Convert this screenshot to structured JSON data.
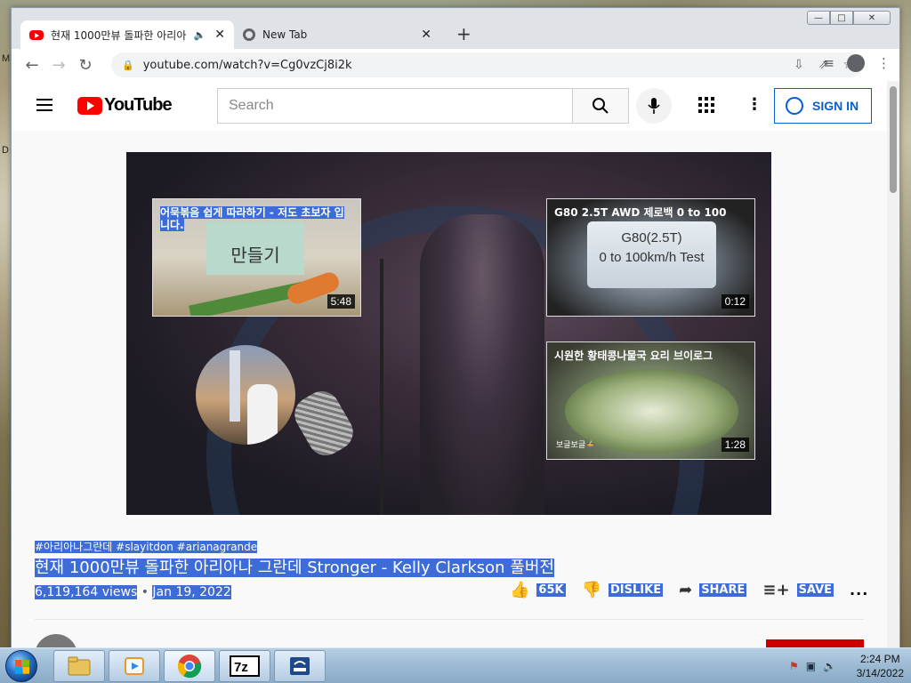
{
  "desktop": {
    "edge_labels": [
      "M",
      "D"
    ]
  },
  "window_controls": {
    "minimize": "—",
    "maximize": "□",
    "close": "✕"
  },
  "tabs": [
    {
      "title": "현재 1000만뷰 돌파한 아리아",
      "speaker": "🔈",
      "close": "✕",
      "favicon": "youtube-icon"
    },
    {
      "title": "New Tab",
      "close": "✕",
      "favicon": "chrome-icon"
    }
  ],
  "new_tab": "+",
  "address_bar": {
    "url": "youtube.com/watch?v=Cg0vzCj8i2k"
  },
  "youtube": {
    "logo_text": "YouTube",
    "search_placeholder": "Search",
    "signin_label": "SIGN IN"
  },
  "video": {
    "end_cards": [
      {
        "title": "어묵볶음 쉽게 따라하기 - 저도 초보자 입니다.",
        "art_text": "만들기",
        "duration": "5:48"
      },
      {
        "title": "G80 2.5T AWD 제로백 0 to 100",
        "art_text_line1": "G80(2.5T)",
        "art_text_line2": "0 to 100km/h Test",
        "duration": "0:12"
      },
      {
        "title": "시원한 황태콩나물국 요리 브이로그",
        "sub": "보글보글🍲",
        "duration": "1:28"
      }
    ]
  },
  "info": {
    "hashtags": "#아리아나그란데 #slayitdon #arianagrande",
    "title": "현재 1000만뷰 돌파한 아리아나 그란데 Stronger - Kelly Clarkson 풀버전",
    "views": "6,119,164 views",
    "dot": "•",
    "date": "Jan 19, 2022",
    "actions": {
      "like": "65K",
      "dislike": "DISLIKE",
      "share": "SHARE",
      "save": "SAVE",
      "more": "..."
    }
  },
  "taskbar": {
    "items": [
      "explorer-icon",
      "media-player-icon",
      "chrome-icon",
      "7zip-icon",
      "app-icon"
    ],
    "time": "2:24 PM",
    "date": "3/14/2022"
  }
}
